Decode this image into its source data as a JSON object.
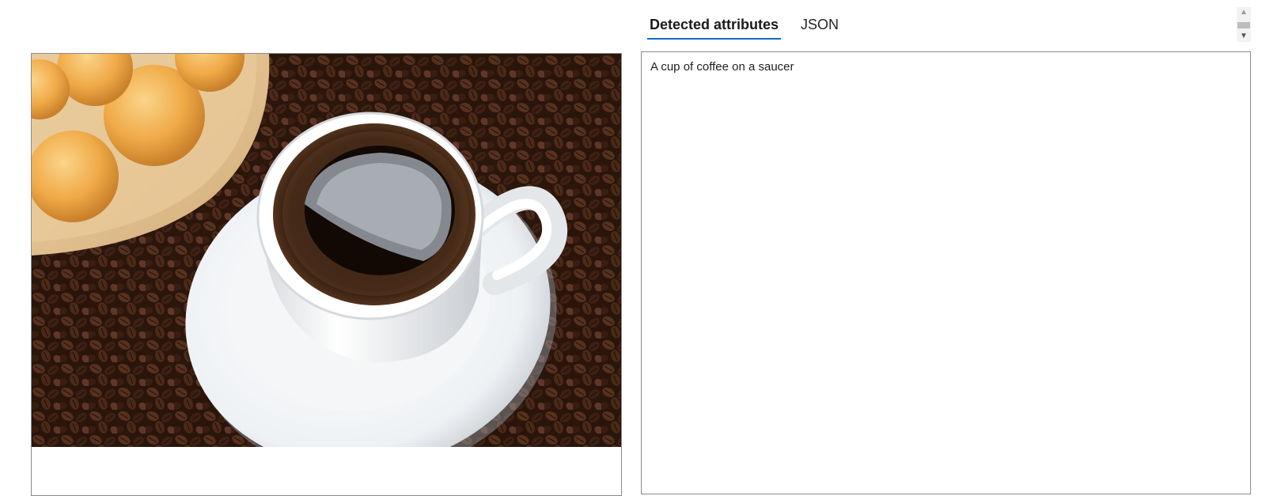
{
  "tabs": [
    {
      "label": "Detected attributes",
      "active": true
    },
    {
      "label": "JSON",
      "active": false
    }
  ],
  "result": {
    "caption": "A cup of coffee on a saucer"
  },
  "image": {
    "subject": "coffee-cup-on-saucer-with-beans-and-cheese-bread"
  },
  "colors": {
    "accent": "#0f6cbd",
    "border": "#8a8a8a"
  }
}
